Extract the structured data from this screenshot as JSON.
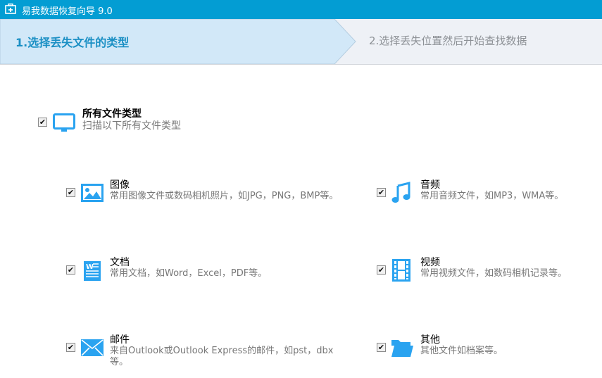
{
  "app": {
    "title": "易我数据恢复向导 9.0"
  },
  "steps": [
    {
      "label": "1.选择丢失文件的类型",
      "active": true
    },
    {
      "label": "2.选择丢失位置然后开始查找数据",
      "active": false
    }
  ],
  "all_types": {
    "title": "所有文件类型",
    "desc": "扫描以下所有文件类型",
    "checked": true
  },
  "types": [
    {
      "title": "图像",
      "desc": "常用图像文件或数码相机照片，如JPG，PNG，BMP等。",
      "checked": true,
      "icon": "image-icon"
    },
    {
      "title": "音频",
      "desc": "常用音频文件，如MP3，WMA等。",
      "checked": true,
      "icon": "music-icon"
    },
    {
      "title": "文档",
      "desc": "常用文档，如Word，Excel，PDF等。",
      "checked": true,
      "icon": "document-icon"
    },
    {
      "title": "视频",
      "desc": "常用视频文件，如数码相机记录等。",
      "checked": true,
      "icon": "video-icon"
    },
    {
      "title": "邮件",
      "desc": "来自Outlook或Outlook Express的邮件，如pst，dbx等。",
      "checked": true,
      "icon": "mail-icon"
    },
    {
      "title": "其他",
      "desc": "其他文件如档案等。",
      "checked": true,
      "icon": "folder-icon"
    }
  ],
  "colors": {
    "titlebar": "#039dd3",
    "accent": "#2aa3f0"
  }
}
